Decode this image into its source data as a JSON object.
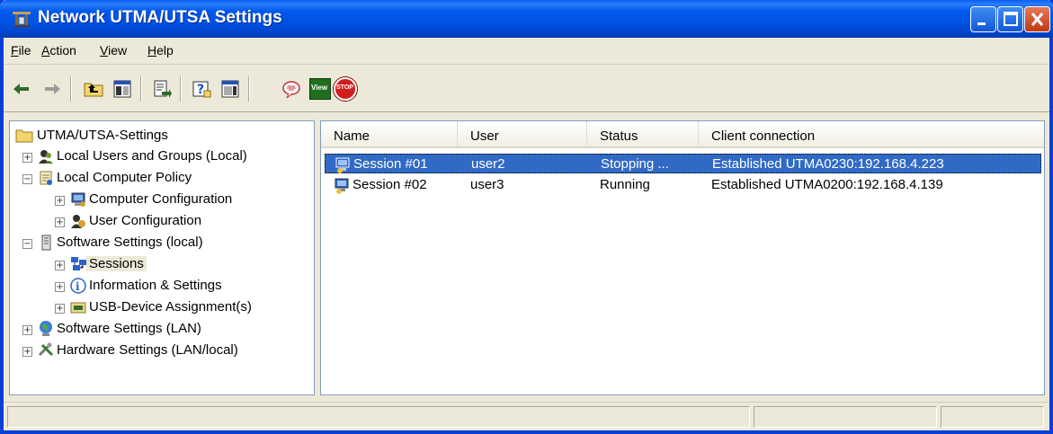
{
  "window": {
    "title": "Network UTMA/UTSA Settings"
  },
  "menu": [
    {
      "label": "File",
      "accel": "F",
      "rest": "ile"
    },
    {
      "label": "Action",
      "accel": "A",
      "rest": "ction"
    },
    {
      "label": "View",
      "accel": "V",
      "rest": "iew"
    },
    {
      "label": "Help",
      "accel": "H",
      "rest": "elp"
    }
  ],
  "toolbar": {
    "icons": [
      "back-arrow-icon",
      "forward-arrow-icon",
      "up-one-level-icon",
      "show-hide-console-tree-icon",
      "export-list-icon",
      "help-icon",
      "show-hide-action-pane-icon",
      "message-icon",
      "view-icon",
      "stop-icon"
    ],
    "view_label": "View",
    "stop_label": "STOP"
  },
  "tree": {
    "root": "UTMA/UTSA-Settings",
    "items": [
      {
        "label": "Local Users and Groups (Local)",
        "expander": "+"
      },
      {
        "label": "Local Computer Policy",
        "expander": "−"
      },
      {
        "label": "Computer Configuration",
        "expander": "+"
      },
      {
        "label": "User Configuration",
        "expander": "+"
      },
      {
        "label": "Software Settings (local)",
        "expander": "−"
      },
      {
        "label": "Sessions",
        "expander": "+"
      },
      {
        "label": "Information & Settings",
        "expander": "+"
      },
      {
        "label": "USB-Device Assignment(s)",
        "expander": "+"
      },
      {
        "label": "Software Settings (LAN)",
        "expander": "+"
      },
      {
        "label": "Hardware Settings (LAN/local)",
        "expander": "+"
      }
    ]
  },
  "list": {
    "columns": [
      "Name",
      "User",
      "Status",
      "Client connection"
    ],
    "rows": [
      {
        "name": "Session #01",
        "user": "user2",
        "status": "Stopping ...",
        "client": "Established UTMA0230:192.168.4.223"
      },
      {
        "name": "Session #02",
        "user": "user3",
        "status": "Running",
        "client": "Established UTMA0200:192.168.4.139"
      }
    ]
  },
  "colors": {
    "titlebar": "#0052e3",
    "selection": "#316ac5",
    "chrome": "#ece9d8"
  }
}
